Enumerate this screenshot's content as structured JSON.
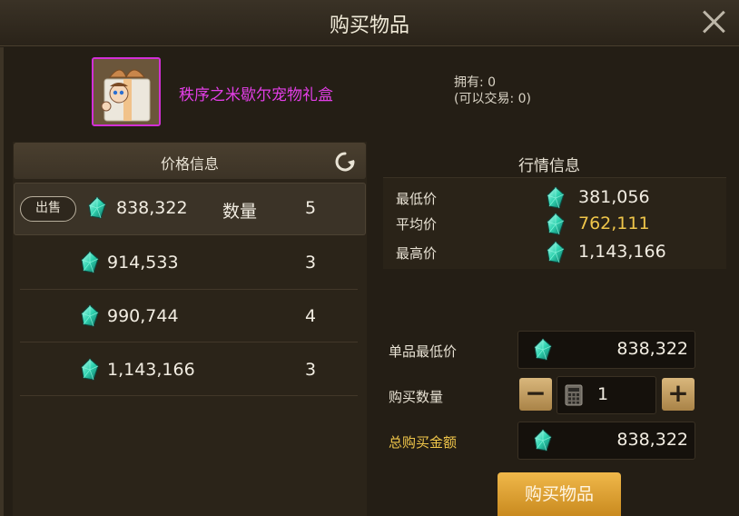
{
  "dialog": {
    "title": "购买物品"
  },
  "item": {
    "name": "秩序之米歇尔宠物礼盒",
    "owned_label": "拥有: 0",
    "tradable_label": "(可以交易: 0)"
  },
  "price_panel": {
    "title": "价格信息",
    "sell_button": "出售",
    "qty_label": "数量",
    "listings": [
      {
        "price": "838,322",
        "qty": "5"
      },
      {
        "price": "914,533",
        "qty": "3"
      },
      {
        "price": "990,744",
        "qty": "4"
      },
      {
        "price": "1,143,166",
        "qty": "3"
      }
    ]
  },
  "market_panel": {
    "title": "行情信息",
    "rows": [
      {
        "label": "最低价",
        "value": "381,056"
      },
      {
        "label": "平均价",
        "value": "762,111"
      },
      {
        "label": "最高价",
        "value": "1,143,166"
      }
    ]
  },
  "purchase": {
    "unit_price_label": "单品最低价",
    "unit_price": "838,322",
    "qty_label": "购买数量",
    "qty": "1",
    "minus": "−",
    "plus": "+",
    "total_label": "总购买金额",
    "total": "838,322",
    "buy_button": "购买物品"
  },
  "colors": {
    "item_name": "#e23ee6",
    "average_price": "#f0c64a",
    "total_label": "#f0c64a",
    "buy_button": "#e0a235"
  },
  "icons": [
    "close-icon",
    "refresh-icon",
    "gem-icon",
    "calculator-icon",
    "minus-icon",
    "plus-icon"
  ]
}
